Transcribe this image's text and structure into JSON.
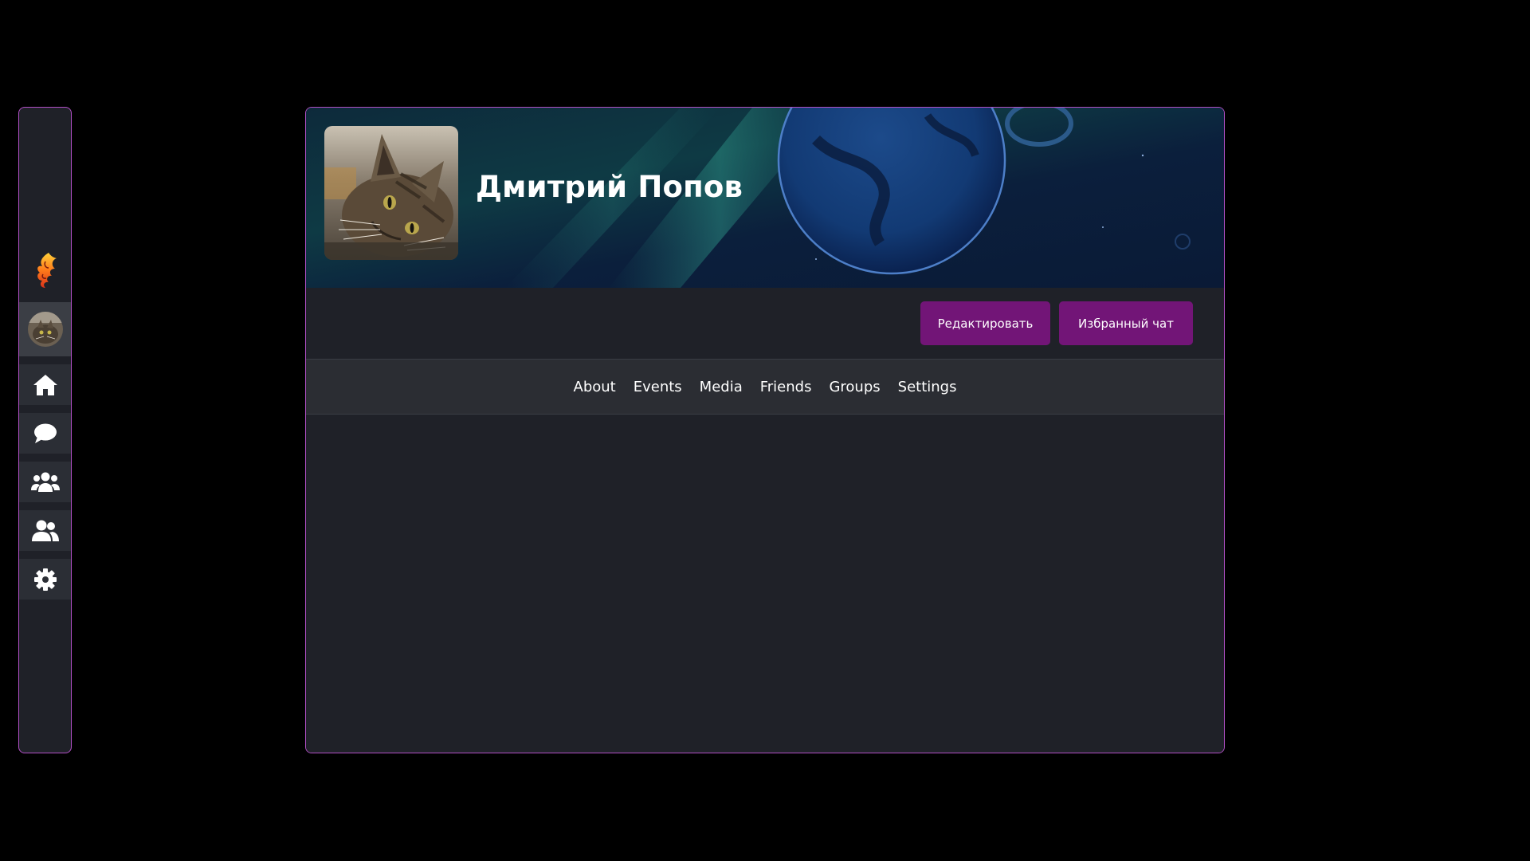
{
  "sidebar": {
    "logo_icon": "phoenix-logo-icon",
    "items": [
      {
        "icon": "home-icon"
      },
      {
        "icon": "chat-bubble-icon"
      },
      {
        "icon": "groups-icon"
      },
      {
        "icon": "friends-icon"
      },
      {
        "icon": "gear-icon"
      }
    ]
  },
  "profile": {
    "name": "Дмитрий Попов",
    "photo": "cat-photo"
  },
  "actions": {
    "edit_label": "Редактировать",
    "favorite_chat_label": "Избранный чат"
  },
  "tabs": [
    {
      "label": "About"
    },
    {
      "label": "Events"
    },
    {
      "label": "Media"
    },
    {
      "label": "Friends"
    },
    {
      "label": "Groups"
    },
    {
      "label": "Settings"
    }
  ],
  "colors": {
    "page_background": "#000000",
    "panel_background": "#1f2128",
    "accent_border": "#b14fc5",
    "button": "#721577",
    "tabs_background": "#2b2d33"
  }
}
